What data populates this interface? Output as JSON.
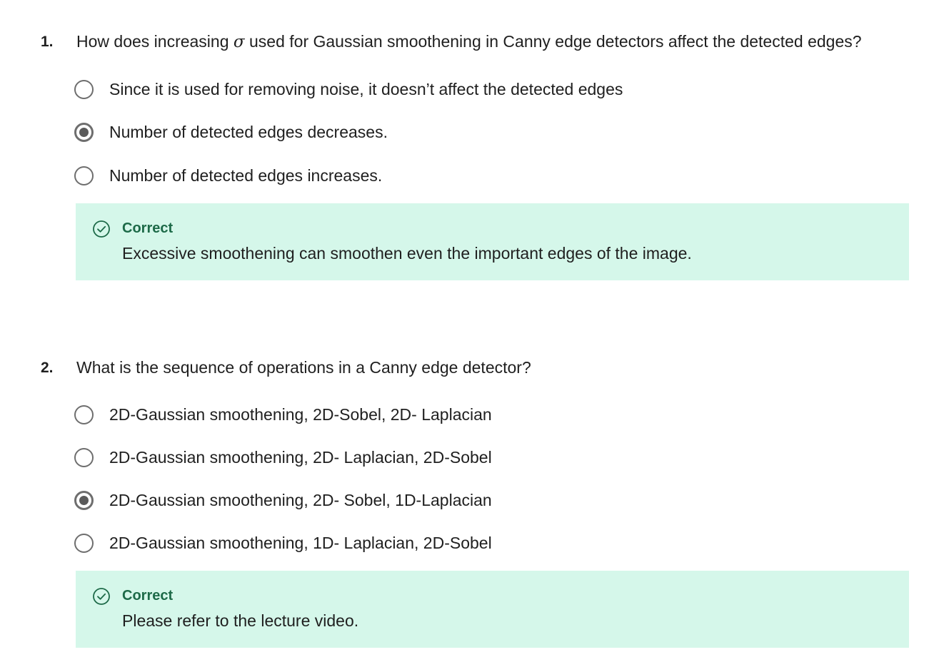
{
  "questions": [
    {
      "number": "1.",
      "text_before": "How does increasing ",
      "symbol": "σ",
      "text_after": " used for Gaussian smoothening in Canny edge detectors affect the detected edges?",
      "options": [
        {
          "label": "Since it is used for removing noise, it doesn’t affect the detected edges",
          "selected": false
        },
        {
          "label": "Number of detected edges decreases.",
          "selected": true
        },
        {
          "label": "Number of detected edges increases.",
          "selected": false
        }
      ],
      "feedback": {
        "status": "Correct",
        "icon": "check-circle-icon",
        "message": "Excessive smoothening can smoothen even the important edges of the image."
      }
    },
    {
      "number": "2.",
      "text": "What is the sequence of operations in a Canny edge detector?",
      "options": [
        {
          "label": "2D-Gaussian smoothening, 2D-Sobel, 2D- Laplacian",
          "selected": false
        },
        {
          "label": "2D-Gaussian smoothening, 2D- Laplacian, 2D-Sobel",
          "selected": false
        },
        {
          "label": "2D-Gaussian smoothening, 2D- Sobel, 1D-Laplacian",
          "selected": true
        },
        {
          "label": "2D-Gaussian smoothening, 1D- Laplacian, 2D-Sobel",
          "selected": false
        }
      ],
      "feedback": {
        "status": "Correct",
        "icon": "check-circle-icon",
        "message": "Please refer to the lecture video."
      }
    }
  ],
  "colors": {
    "feedback_bg": "#d5f7ea",
    "feedback_title": "#1d6a48",
    "radio_border": "#6e6e6e"
  }
}
